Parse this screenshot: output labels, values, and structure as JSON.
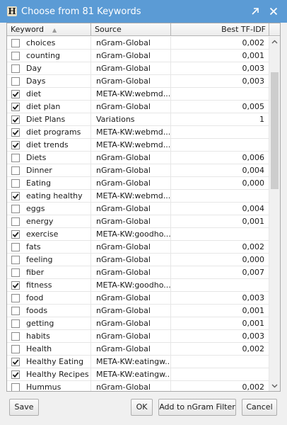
{
  "window": {
    "title": "Choose from 81 Keywords",
    "app_icon_glyph": "H"
  },
  "columns": {
    "keyword": "Keyword",
    "source": "Source",
    "best_tf_idf": "Best TF-IDF"
  },
  "rows": [
    {
      "checked": false,
      "keyword": "choices",
      "source": "nGram-Global",
      "tfidf": "0,002"
    },
    {
      "checked": false,
      "keyword": "counting",
      "source": "nGram-Global",
      "tfidf": "0,001"
    },
    {
      "checked": false,
      "keyword": "Day",
      "source": "nGram-Global",
      "tfidf": "0,003"
    },
    {
      "checked": false,
      "keyword": "Days",
      "source": "nGram-Global",
      "tfidf": "0,003"
    },
    {
      "checked": true,
      "keyword": "diet",
      "source": "META-KW:webmd....",
      "tfidf": ""
    },
    {
      "checked": true,
      "keyword": "diet plan",
      "source": "nGram-Global",
      "tfidf": "0,005"
    },
    {
      "checked": true,
      "keyword": "Diet Plans",
      "source": "Variations",
      "tfidf": "1"
    },
    {
      "checked": true,
      "keyword": "diet programs",
      "source": "META-KW:webmd....",
      "tfidf": ""
    },
    {
      "checked": true,
      "keyword": "diet trends",
      "source": "META-KW:webmd....",
      "tfidf": ""
    },
    {
      "checked": false,
      "keyword": "Diets",
      "source": "nGram-Global",
      "tfidf": "0,006"
    },
    {
      "checked": false,
      "keyword": "Dinner",
      "source": "nGram-Global",
      "tfidf": "0,004"
    },
    {
      "checked": false,
      "keyword": "Eating",
      "source": "nGram-Global",
      "tfidf": "0,000"
    },
    {
      "checked": true,
      "keyword": "eating healthy",
      "source": "META-KW:webmd....",
      "tfidf": ""
    },
    {
      "checked": false,
      "keyword": "eggs",
      "source": "nGram-Global",
      "tfidf": "0,004"
    },
    {
      "checked": false,
      "keyword": "energy",
      "source": "nGram-Global",
      "tfidf": "0,001"
    },
    {
      "checked": true,
      "keyword": "exercise",
      "source": "META-KW:goodho...",
      "tfidf": ""
    },
    {
      "checked": false,
      "keyword": "fats",
      "source": "nGram-Global",
      "tfidf": "0,002"
    },
    {
      "checked": false,
      "keyword": "feeling",
      "source": "nGram-Global",
      "tfidf": "0,000"
    },
    {
      "checked": false,
      "keyword": "fiber",
      "source": "nGram-Global",
      "tfidf": "0,007"
    },
    {
      "checked": true,
      "keyword": "fitness",
      "source": "META-KW:goodho...",
      "tfidf": ""
    },
    {
      "checked": false,
      "keyword": "food",
      "source": "nGram-Global",
      "tfidf": "0,003"
    },
    {
      "checked": false,
      "keyword": "foods",
      "source": "nGram-Global",
      "tfidf": "0,001"
    },
    {
      "checked": false,
      "keyword": "getting",
      "source": "nGram-Global",
      "tfidf": "0,001"
    },
    {
      "checked": false,
      "keyword": "habits",
      "source": "nGram-Global",
      "tfidf": "0,003"
    },
    {
      "checked": false,
      "keyword": "Health",
      "source": "nGram-Global",
      "tfidf": "0,002"
    },
    {
      "checked": true,
      "keyword": "Healthy Eating",
      "source": "META-KW:eatingw...",
      "tfidf": ""
    },
    {
      "checked": true,
      "keyword": "Healthy Recipes",
      "source": "META-KW:eatingw...",
      "tfidf": ""
    },
    {
      "checked": false,
      "keyword": "Hummus",
      "source": "nGram-Global",
      "tfidf": "0,002"
    }
  ],
  "buttons": {
    "save": "Save",
    "ok": "OK",
    "add_ngram": "Add to nGram Filter",
    "cancel": "Cancel"
  },
  "colors": {
    "titlebar": "#5b9bd5",
    "checkmark": "#1a1a1a"
  }
}
